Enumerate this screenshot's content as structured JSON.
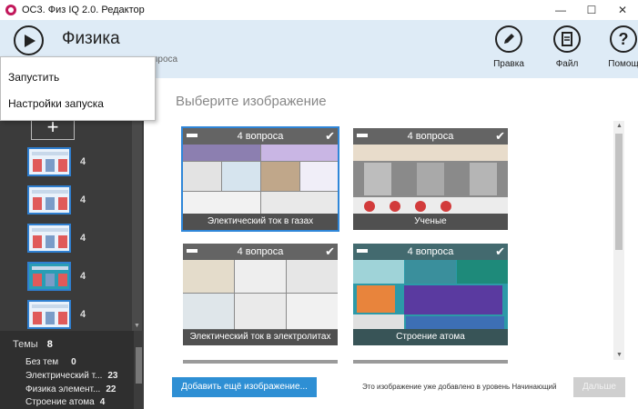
{
  "window": {
    "title": "ОС3. Физ IQ 2.0. Редактор",
    "minimize": "—",
    "maximize": "☐",
    "close": "✕"
  },
  "header": {
    "course_title": "Физика",
    "sub_level_partial": "просa",
    "tools": [
      {
        "label": "Правка",
        "icon": "pencil-icon"
      },
      {
        "label": "Файл",
        "icon": "file-icon"
      },
      {
        "label": "Помощ",
        "icon": "help-icon"
      }
    ]
  },
  "menu": {
    "items": [
      "Запустить",
      "Настройки запуска"
    ]
  },
  "left_panel": {
    "add_label": "+",
    "slides": [
      {
        "count": "4"
      },
      {
        "count": "4"
      },
      {
        "count": "4"
      },
      {
        "count": "4"
      },
      {
        "count": "4"
      }
    ],
    "topics_header": "Темы",
    "topics_count": "8",
    "topics": [
      {
        "name": "Без тем",
        "count": "0"
      },
      {
        "name": "Электрический т...",
        "count": "23"
      },
      {
        "name": "Физика элемент...",
        "count": "22"
      },
      {
        "name": "Строение атома",
        "count": "4"
      }
    ]
  },
  "main": {
    "title": "Выберите изображение",
    "cards": [
      {
        "questions": "4 вопроса",
        "caption": "Электический ток в газах",
        "selected": true
      },
      {
        "questions": "4 вопроса",
        "caption": "Ученые",
        "selected": false
      },
      {
        "questions": "4 вопроса",
        "caption": "Электический ток в электролитах",
        "selected": false
      },
      {
        "questions": "4 вопроса",
        "caption": "Строение атома",
        "selected": false
      }
    ],
    "check_glyph": "✔",
    "add_button": "Добавить ещё изображение...",
    "info": "Это изображение уже добавлено в уровень Начинающий",
    "next_button": "Дальше"
  },
  "colors": {
    "header_bg": "#deebf6",
    "accent": "#2e8fd4",
    "left_panel": "#3b3b3b"
  }
}
